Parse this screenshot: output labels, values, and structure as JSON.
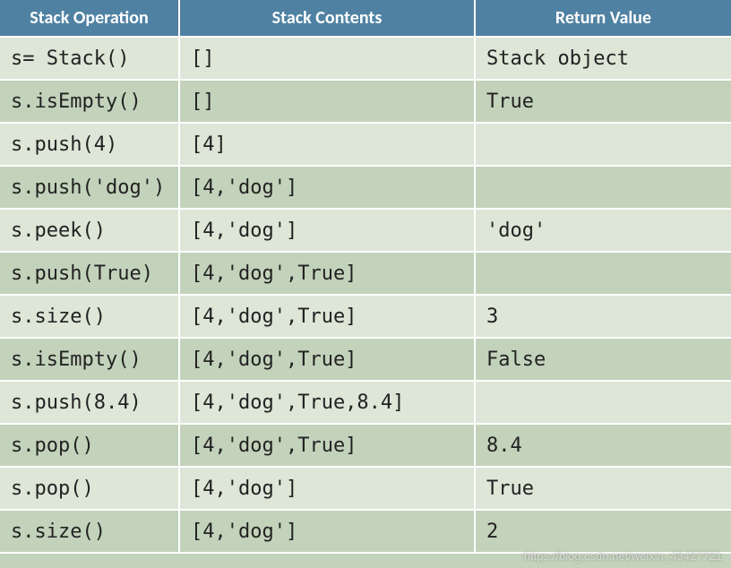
{
  "table": {
    "headers": [
      "Stack Operation",
      "Stack Contents",
      "Return Value"
    ],
    "rows": [
      {
        "operation": "s= Stack()",
        "contents": "[]",
        "return": "Stack object"
      },
      {
        "operation": "s.isEmpty()",
        "contents": "[]",
        "return": "True"
      },
      {
        "operation": "s.push(4)",
        "contents": "[4]",
        "return": ""
      },
      {
        "operation": "s.push('dog')",
        "contents": "[4,'dog']",
        "return": ""
      },
      {
        "operation": "s.peek()",
        "contents": "[4,'dog']",
        "return": "'dog'"
      },
      {
        "operation": "s.push(True)",
        "contents": "[4,'dog',True]",
        "return": ""
      },
      {
        "operation": "s.size()",
        "contents": "[4,'dog',True]",
        "return": "3"
      },
      {
        "operation": "s.isEmpty()",
        "contents": "[4,'dog',True]",
        "return": "False"
      },
      {
        "operation": "s.push(8.4)",
        "contents": "[4,'dog',True,8.4]",
        "return": ""
      },
      {
        "operation": "s.pop()",
        "contents": "[4,'dog',True]",
        "return": "8.4"
      },
      {
        "operation": "s.pop()",
        "contents": "[4,'dog']",
        "return": "True"
      },
      {
        "operation": "s.size()",
        "contents": "[4,'dog']",
        "return": "2"
      }
    ]
  },
  "watermark": "https://blog.csdn.net/weixin_43427721"
}
